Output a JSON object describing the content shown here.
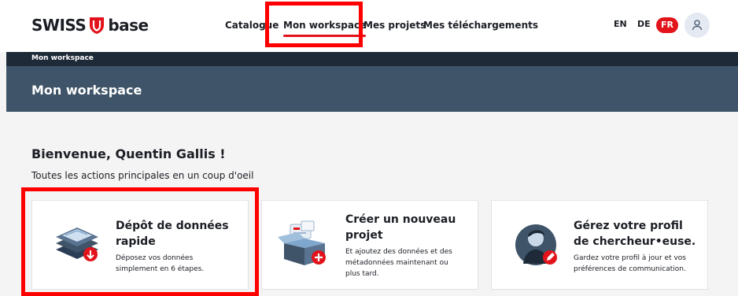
{
  "header": {
    "logo_left": "SWISS",
    "logo_right": "base",
    "nav": [
      {
        "label": "Catalogue"
      },
      {
        "label": "Mon workspace",
        "active": true
      },
      {
        "label": "Mes projets"
      },
      {
        "label": "Mes téléchargements"
      }
    ],
    "languages": [
      {
        "label": "EN"
      },
      {
        "label": "DE"
      },
      {
        "label": "FR",
        "active": true
      }
    ],
    "account_icon": "user-icon"
  },
  "breadcrumb": "Mon workspace",
  "page_title": "Mon workspace",
  "welcome": "Bienvenue, Quentin Gallis !",
  "subtitle": "Toutes les actions principales en un coup d'oeil",
  "cards": [
    {
      "title": "Dépôt de données rapide",
      "description": "Déposez vos données simplement en 6 étapes.",
      "icon": "data-deposit-icon"
    },
    {
      "title": "Créer un nouveau projet",
      "description": "Et ajoutez des données et des métadonnées maintenant ou plus tard.",
      "icon": "new-project-icon"
    },
    {
      "title": "Gérez votre profil de chercheur•euse.",
      "description": "Gardez votre profil à jour et vos préférences de communication.",
      "icon": "researcher-profile-icon"
    }
  ],
  "colors": {
    "accent": "#e2131b",
    "dark_band": "#1f2a38",
    "header_band": "#3f5468",
    "highlight": "#ff0000"
  }
}
